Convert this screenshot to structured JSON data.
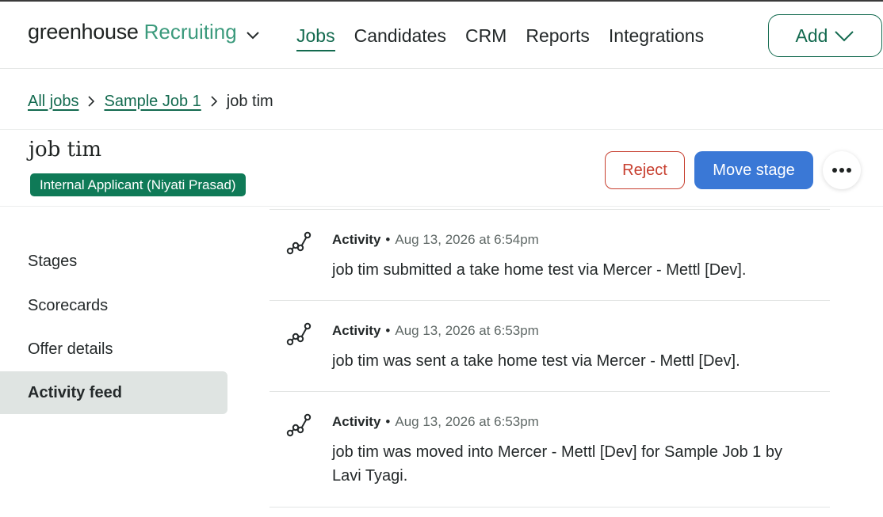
{
  "nav": {
    "logo_word": "greenhouse",
    "logo_product": "Recruiting",
    "links": [
      {
        "label": "Jobs",
        "active": true
      },
      {
        "label": "Candidates",
        "active": false
      },
      {
        "label": "CRM",
        "active": false
      },
      {
        "label": "Reports",
        "active": false
      },
      {
        "label": "Integrations",
        "active": false
      }
    ],
    "add_label": "Add"
  },
  "breadcrumb": {
    "items": [
      "All jobs",
      "Sample Job 1"
    ],
    "current": "job tim"
  },
  "candidate": {
    "name": "job tim",
    "badge": "Internal Applicant (Niyati Prasad)"
  },
  "actions": {
    "reject": "Reject",
    "move_stage": "Move stage",
    "more": "•••"
  },
  "sidebar": {
    "items": [
      {
        "label": "Stages",
        "active": false
      },
      {
        "label": "Scorecards",
        "active": false
      },
      {
        "label": "Offer details",
        "active": false
      },
      {
        "label": "Activity feed",
        "active": true
      }
    ]
  },
  "feed": {
    "items": [
      {
        "type": "Activity",
        "sep": "•",
        "time": "Aug 13, 2026 at 6:54pm",
        "text": "job tim submitted a take home test via Mercer - Mettl [Dev]."
      },
      {
        "type": "Activity",
        "sep": "•",
        "time": "Aug 13, 2026 at 6:53pm",
        "text": "job tim was sent a take home test via Mercer - Mettl [Dev]."
      },
      {
        "type": "Activity",
        "sep": "•",
        "time": "Aug 13, 2026 at 6:53pm",
        "text": "job tim was moved into Mercer - Mettl [Dev] for Sample Job 1 by Lavi Tyagi."
      }
    ]
  },
  "colors": {
    "brand_green": "#136a4f",
    "badge_green": "#0f7a57",
    "reject_red": "#c73f2f",
    "primary_blue": "#3a78d6",
    "active_menu_bg": "#dfe4e2"
  },
  "icons": {
    "nav_dropdown": "chevron-down-icon",
    "breadcrumb_sep": "chevron-right-icon",
    "feed": "activity-graph-icon",
    "more": "ellipsis-icon"
  }
}
